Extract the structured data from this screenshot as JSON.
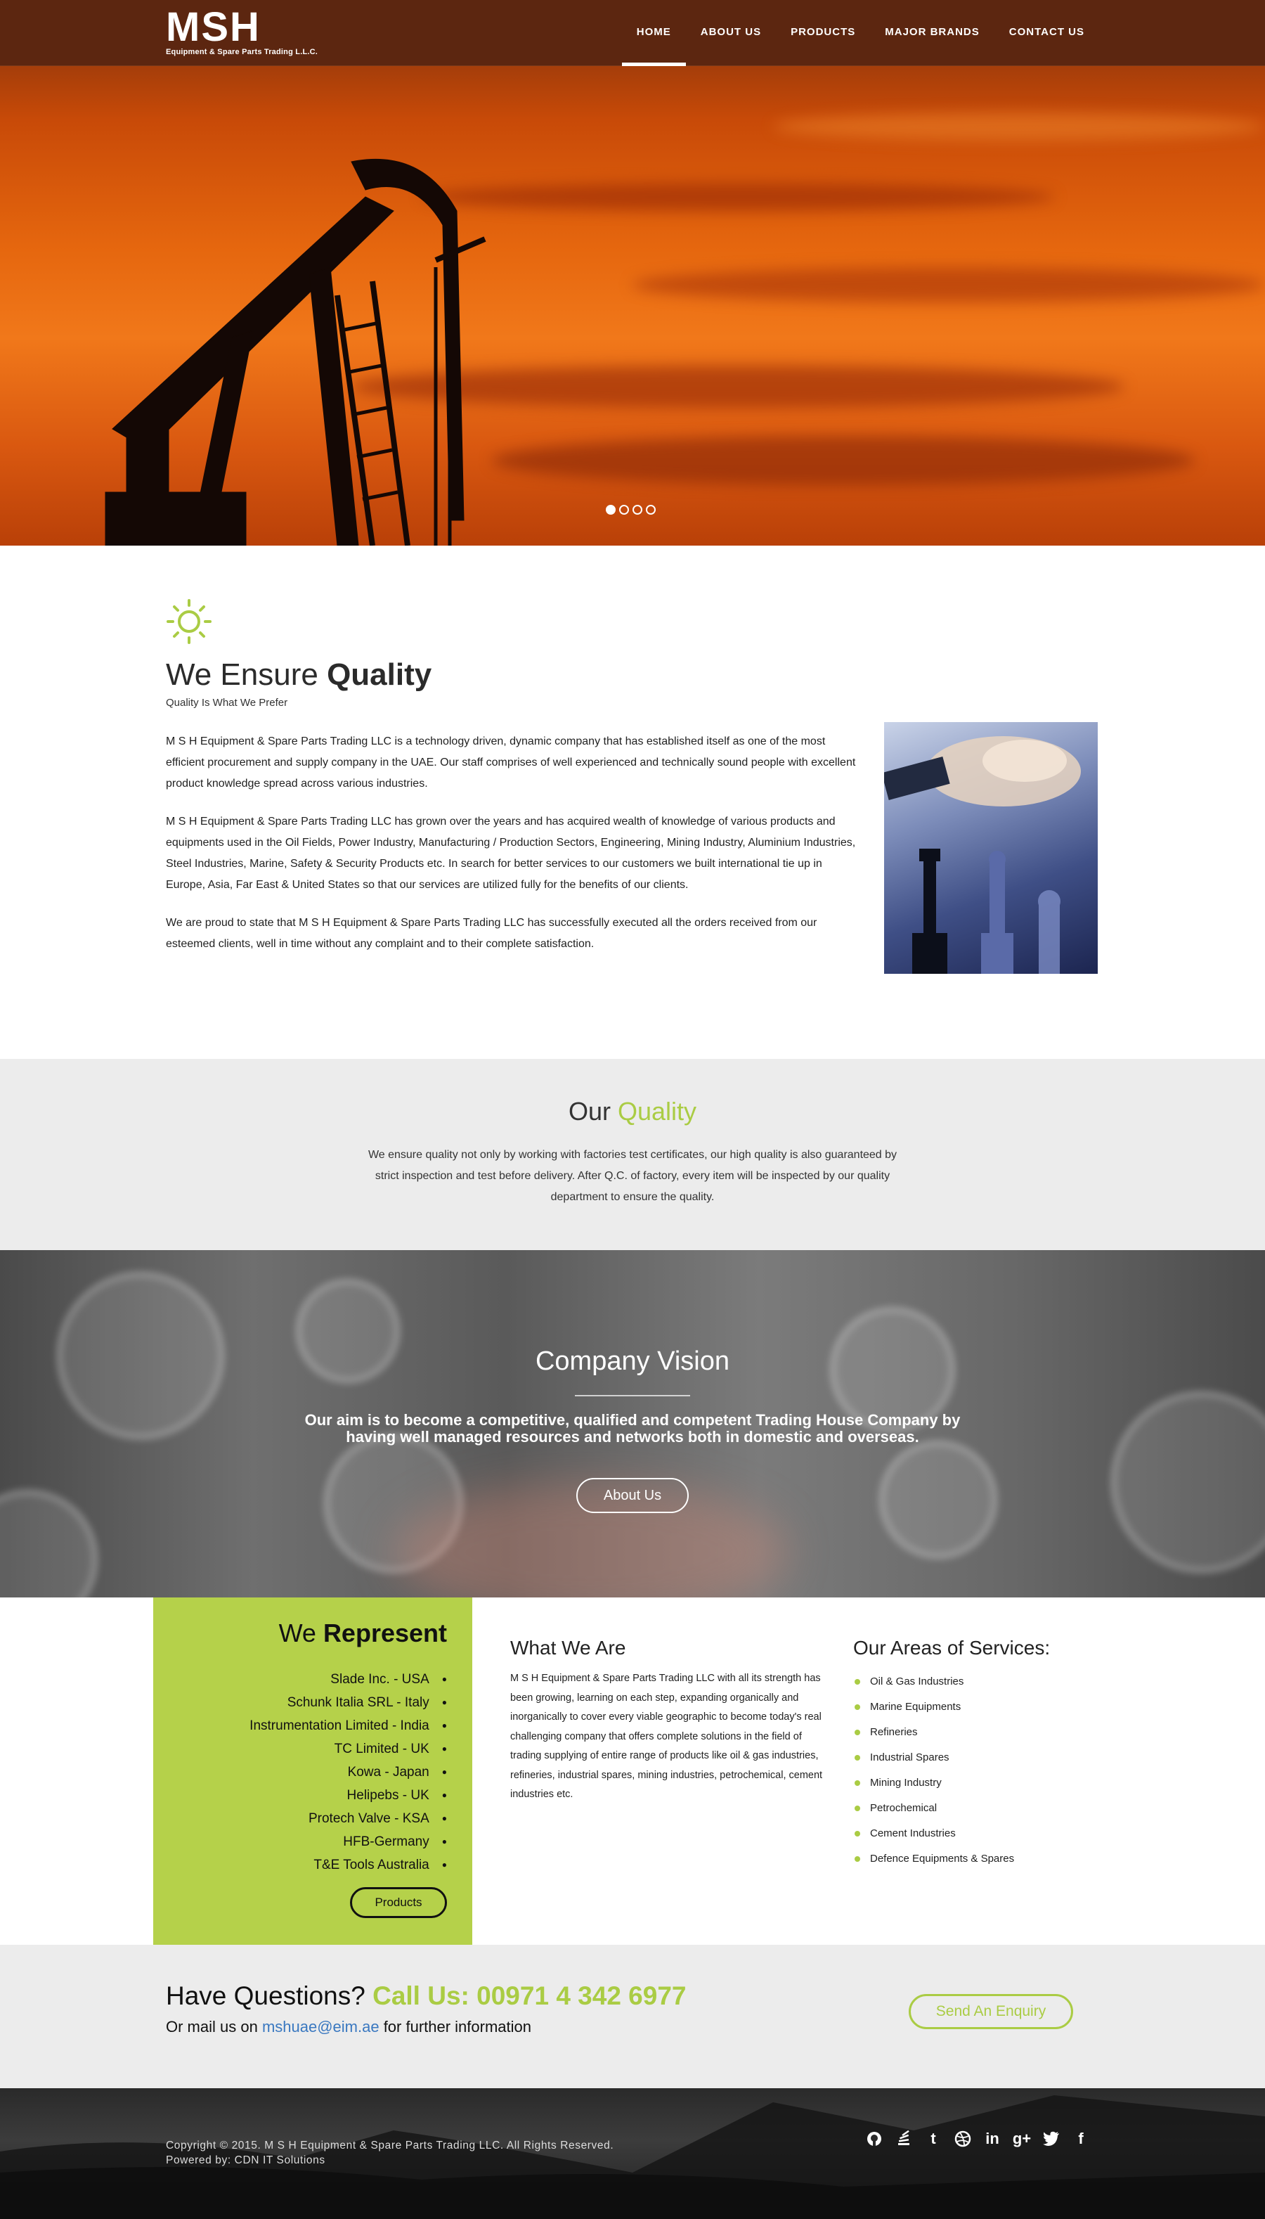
{
  "header": {
    "logo_mark": "MSH",
    "logo_sub": "Equipment & Spare Parts Trading L.L.C.",
    "nav": [
      "HOME",
      "ABOUT US",
      "PRODUCTS",
      "MAJOR BRANDS",
      "CONTACT US"
    ],
    "active_nav": "HOME"
  },
  "hero": {
    "slides": 4,
    "current_slide": 1
  },
  "quality": {
    "title_light": "We Ensure ",
    "title_bold": "Quality",
    "subtitle": "Quality Is What We Prefer",
    "paragraphs": [
      "M S H Equipment & Spare Parts Trading LLC is a technology driven, dynamic company that has established itself as one of the most efficient procurement and supply company in the UAE. Our staff comprises of well experienced and technically sound people with excellent product knowledge spread across various industries.",
      "M S H Equipment & Spare Parts Trading LLC has grown over the years and has acquired wealth of knowledge of various products and equipments used in the Oil Fields, Power Industry, Manufacturing / Production Sectors, Engineering, Mining Industry, Aluminium Industries, Steel Industries, Marine, Safety & Security Products etc. In search for better services to our customers we built international tie up in Europe, Asia, Far East & United States so that our services are utilized fully for the benefits of our clients.",
      "We are proud to state that M S H Equipment & Spare Parts Trading LLC has successfully executed all the orders received from our esteemed clients, well in time without any complaint and to their complete satisfaction."
    ]
  },
  "our_quality": {
    "title_plain": "Our ",
    "title_accent": "Quality",
    "text": "We ensure quality not only by working with factories test certificates, our high quality is also guaranteed by strict inspection and test before delivery. After Q.C. of factory, every item will be inspected by our quality department to ensure the quality."
  },
  "vision": {
    "title": "Company Vision",
    "text": "Our aim is to become a competitive, qualified and competent Trading House Company by having well managed resources and networks both in domestic and overseas.",
    "button": "About Us"
  },
  "represent": {
    "title_light": "We ",
    "title_bold": "Represent",
    "items": [
      "Slade Inc. - USA",
      "Schunk Italia SRL - Italy",
      "Instrumentation Limited - India",
      "TC Limited - UK",
      "Kowa - Japan",
      "Helipebs - UK",
      "Protech Valve - KSA",
      "HFB-Germany",
      "T&E Tools Australia"
    ],
    "button": "Products"
  },
  "what_we_are": {
    "title": "What We Are",
    "text": "M S H Equipment & Spare Parts Trading LLC with all its strength has been growing, learning on each step, expanding organically and inorganically to cover every viable geographic to become today's real challenging company that offers complete solutions in the field of trading supplying of entire range of products like oil & gas industries, refineries, industrial spares, mining industries, petrochemical, cement industries etc."
  },
  "areas": {
    "title": "Our Areas of Services:",
    "items": [
      "Oil & Gas Industries",
      "Marine Equipments",
      "Refineries",
      "Industrial Spares",
      "Mining Industry",
      "Petrochemical",
      "Cement Industries",
      "Defence Equipments & Spares"
    ]
  },
  "questions": {
    "title_plain": "Have Questions? ",
    "title_accent": "Call Us: 00971 4 342 6977",
    "mail_prefix": "Or mail us on ",
    "email": "mshuae@eim.ae",
    "mail_suffix": " for further information",
    "button": "Send An Enquiry"
  },
  "footer": {
    "copyright": "Copyright © 2015. M S H Equipment & Spare Parts Trading LLC. All Rights Reserved.",
    "powered": "Powered by: CDN IT Solutions",
    "social_icons": [
      "github-icon",
      "stackexchange-icon",
      "tumblr-icon",
      "dribbble-icon",
      "linkedin-icon",
      "google-plus-icon",
      "twitter-icon",
      "facebook-icon"
    ]
  },
  "colors": {
    "accent": "#aacc44",
    "header_bg": "#5c2610",
    "link": "#3a78c0"
  }
}
